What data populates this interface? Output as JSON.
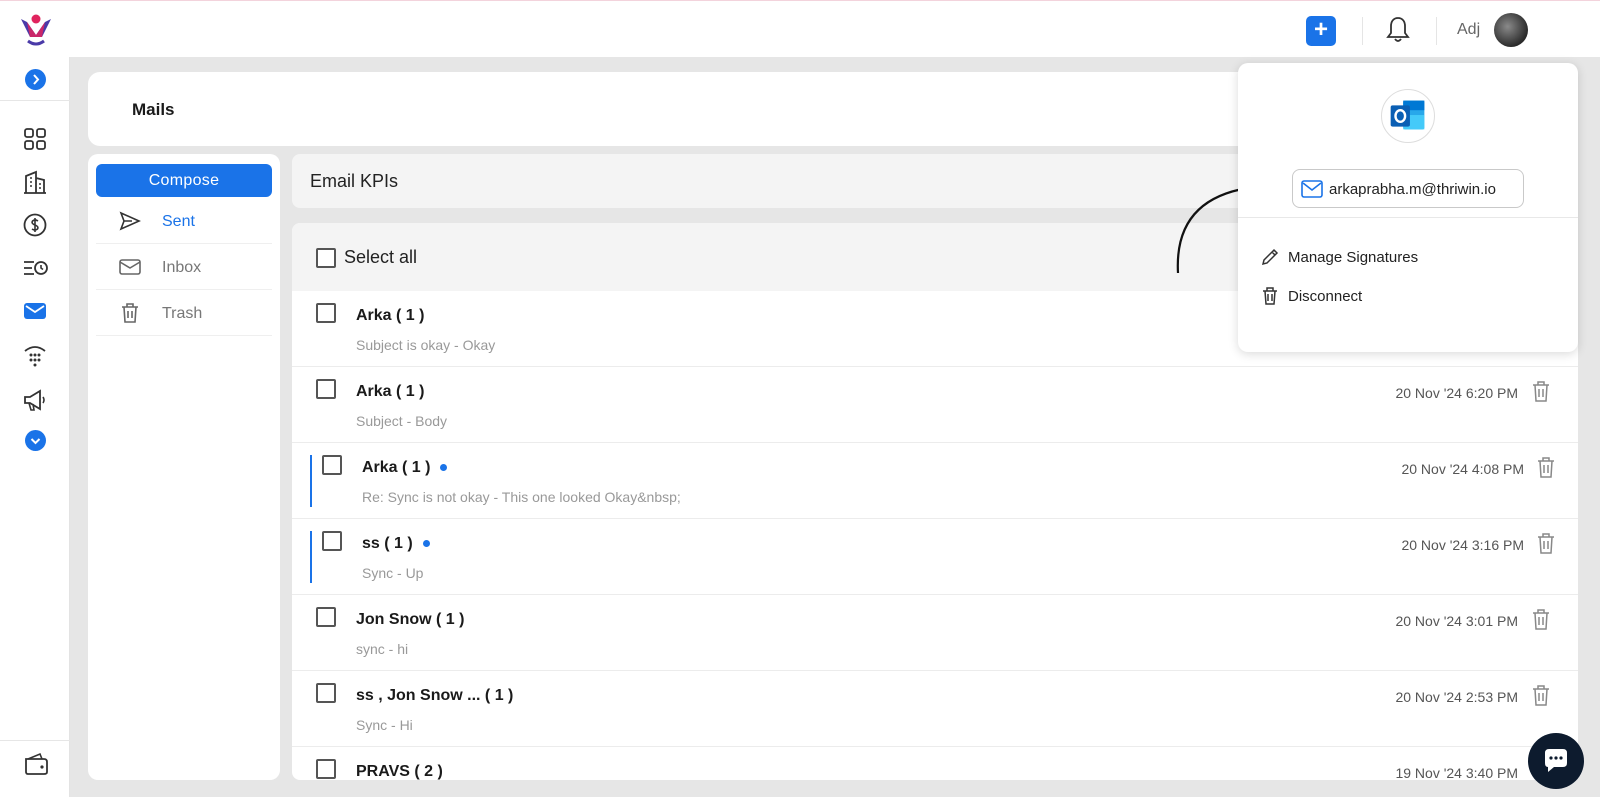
{
  "topbar": {
    "add_label": "+",
    "user_name": "Adj"
  },
  "nav": {
    "items": [
      "dashboard-icon",
      "building-icon",
      "dollar-icon",
      "activity-icon",
      "mail-icon",
      "phone-dial-icon",
      "megaphone-icon"
    ],
    "active": "mail-icon"
  },
  "page": {
    "title": "Mails"
  },
  "folders": {
    "compose_label": "Compose",
    "items": [
      {
        "label": "Sent",
        "icon": "send-icon",
        "active": true
      },
      {
        "label": "Inbox",
        "icon": "inbox-icon",
        "active": false
      },
      {
        "label": "Trash",
        "icon": "trash-icon",
        "active": false
      }
    ]
  },
  "kpi": {
    "title": "Email KPIs"
  },
  "list": {
    "select_all_label": "Select all",
    "rows": [
      {
        "sender": "Arka ( 1 )",
        "snippet": "Subject is okay -  Okay",
        "date": "",
        "unread": false
      },
      {
        "sender": "Arka ( 1 )",
        "snippet": "Subject -  Body",
        "date": "20 Nov '24 6:20 PM",
        "unread": false
      },
      {
        "sender": "Arka ( 1 )",
        "snippet": "Re: Sync is not okay -  This one looked Okay&nbsp;",
        "date": "20 Nov '24 4:08 PM",
        "unread": true
      },
      {
        "sender": "ss ( 1 )",
        "snippet": "Sync -  Up",
        "date": "20 Nov '24 3:16 PM",
        "unread": true
      },
      {
        "sender": "Jon Snow ( 1 )",
        "snippet": "sync -  hi",
        "date": "20 Nov '24 3:01 PM",
        "unread": false
      },
      {
        "sender": "ss ,   Jon Snow ... ( 1 )",
        "snippet": "Sync -  Hi",
        "date": "20 Nov '24 2:53 PM",
        "unread": false
      },
      {
        "sender": "PRAVS ( 2 )",
        "snippet": "",
        "date": "19 Nov '24 3:40 PM",
        "unread": false
      }
    ]
  },
  "dropdown": {
    "account_email": "arkaprabha.m@thriwin.io",
    "manage_signatures": "Manage Signatures",
    "disconnect": "Disconnect"
  },
  "colors": {
    "accent": "#1a73e8",
    "chat": "#0d1b2e"
  }
}
